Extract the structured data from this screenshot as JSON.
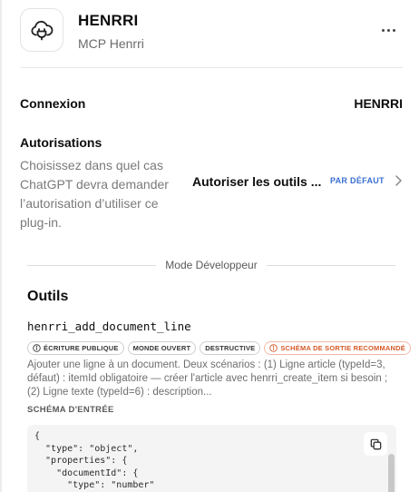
{
  "header": {
    "title": "HENRRI",
    "subtitle": "MCP Henrri",
    "app_icon": "plug-cloud-icon",
    "more_icon": "more-horizontal-icon"
  },
  "connection": {
    "label": "Connexion",
    "value": "HENRRI"
  },
  "permissions": {
    "title": "Autorisations",
    "description": "Choisissez dans quel cas ChatGPT devra demander l’autorisation d’utiliser ce plug-in.",
    "selected": "Autoriser les outils ...",
    "default_tag": "PAR DÉFAUT",
    "chevron_icon": "chevron-right-icon"
  },
  "developer_mode": {
    "label": "Mode Développeur"
  },
  "tools": {
    "title": "Outils",
    "items": [
      {
        "name": "henrri_add_document_line",
        "badges": [
          {
            "label": "ÉCRITURE PUBLIQUE",
            "icon": "info-icon"
          },
          {
            "label": "MONDE OUVERT"
          },
          {
            "label": "DESTRUCTIVE"
          },
          {
            "label": "SCHÉMA DE SORTIE RECOMMANDÉ",
            "icon": "info-icon"
          }
        ],
        "description": "Ajouter une ligne à un document. Deux scénarios : (1) Ligne article (typeId=3, défaut) : itemId obligatoire — créer l'article avec henrri_create_item si besoin ; (2) Ligne texte (typeId=6) : description...",
        "schema_label": "SCHÉMA D'ENTRÉE",
        "schema_code": "{\n  \"type\": \"object\",\n  \"properties\": {\n    \"documentId\": {\n      \"type\": \"number\"",
        "copy_icon": "copy-icon"
      }
    ]
  },
  "colors": {
    "accent": "#3b6fd1",
    "warning": "#d45a2a",
    "muted_text": "#7a7a7a"
  }
}
